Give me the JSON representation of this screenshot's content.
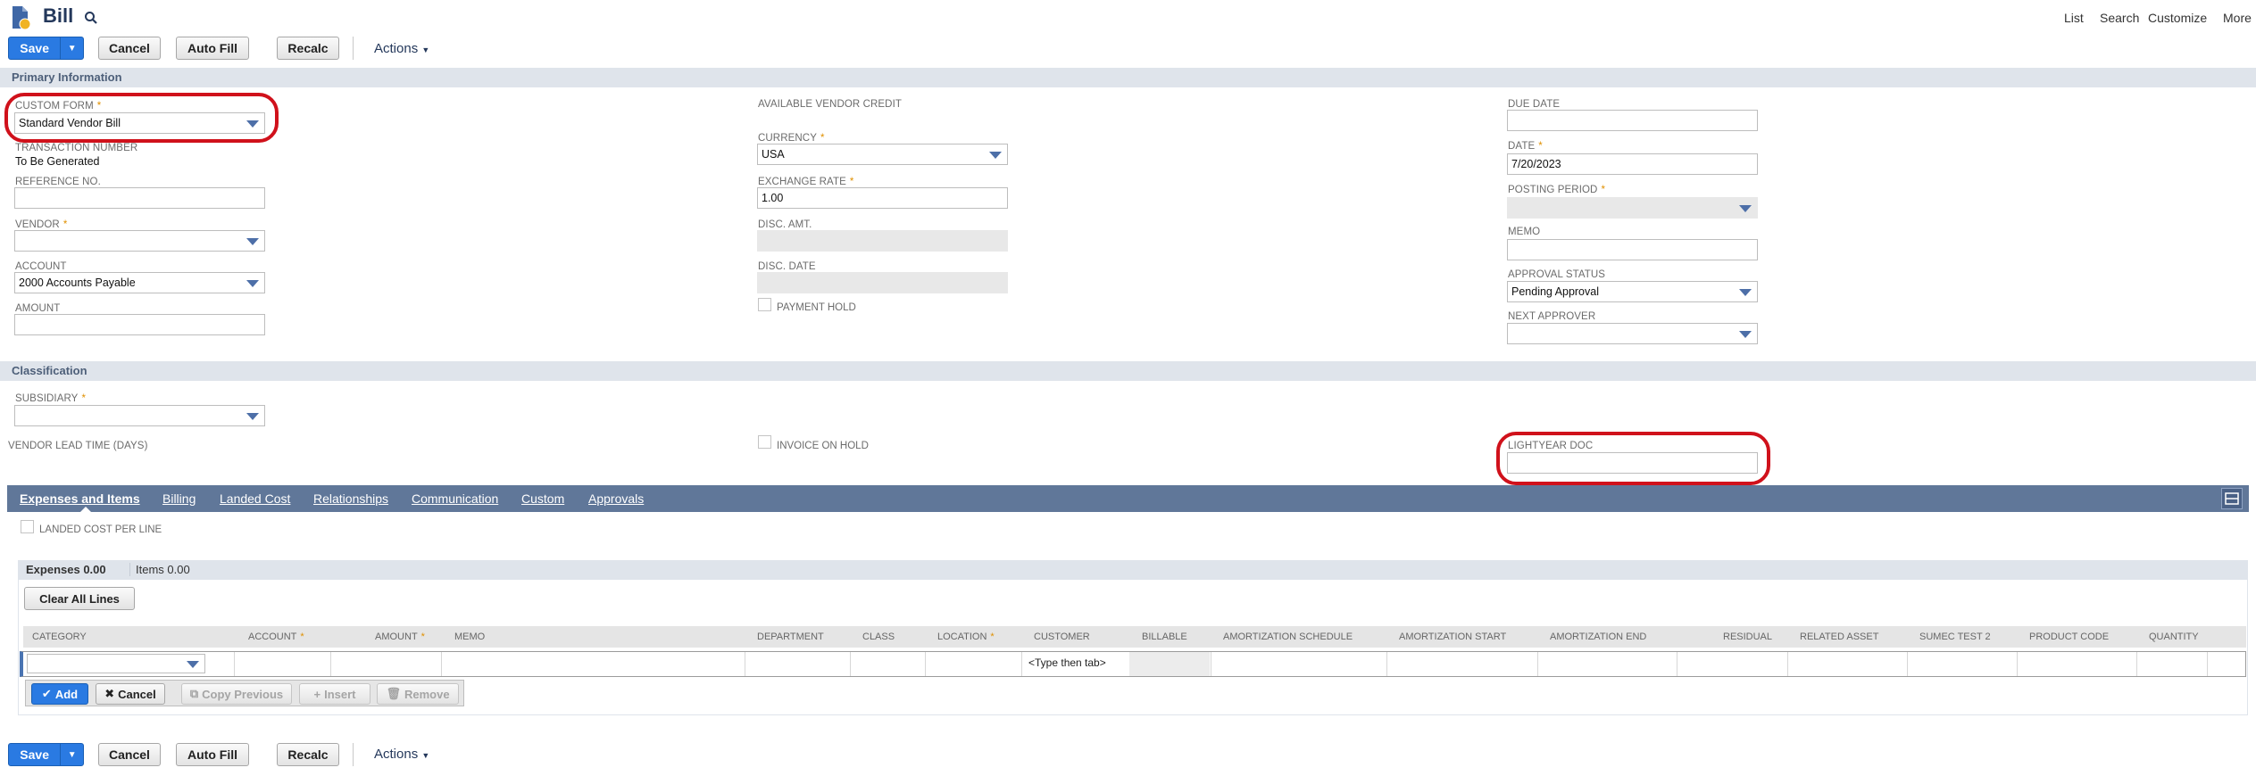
{
  "header": {
    "title": "Bill",
    "nav": [
      "List",
      "Search",
      "Customize",
      "More"
    ]
  },
  "toolbar": {
    "save": "Save",
    "cancel": "Cancel",
    "auto_fill": "Auto Fill",
    "recalc": "Recalc",
    "actions": "Actions"
  },
  "sections": {
    "primary": "Primary Information",
    "classification": "Classification"
  },
  "primary": {
    "custom_form": {
      "label": "CUSTOM FORM",
      "value": "Standard Vendor Bill"
    },
    "transaction_number": {
      "label": "TRANSACTION NUMBER",
      "value": "To Be Generated"
    },
    "reference_no": {
      "label": "REFERENCE NO."
    },
    "vendor": {
      "label": "VENDOR"
    },
    "account": {
      "label": "ACCOUNT",
      "value": "2000 Accounts Payable"
    },
    "amount": {
      "label": "AMOUNT"
    },
    "available_vendor_credit": {
      "label": "AVAILABLE VENDOR CREDIT"
    },
    "currency": {
      "label": "CURRENCY",
      "value": "USA"
    },
    "exchange_rate": {
      "label": "EXCHANGE RATE",
      "value": "1.00"
    },
    "disc_amt": {
      "label": "DISC. AMT."
    },
    "disc_date": {
      "label": "DISC. DATE"
    },
    "payment_hold": {
      "label": "PAYMENT HOLD"
    },
    "due_date": {
      "label": "DUE DATE"
    },
    "date": {
      "label": "DATE",
      "value": "7/20/2023"
    },
    "posting_period": {
      "label": "POSTING PERIOD"
    },
    "memo": {
      "label": "MEMO"
    },
    "approval_status": {
      "label": "APPROVAL STATUS",
      "value": "Pending Approval"
    },
    "next_approver": {
      "label": "NEXT APPROVER"
    }
  },
  "classification": {
    "subsidiary": {
      "label": "SUBSIDIARY"
    },
    "vendor_lead_time": {
      "label": "VENDOR LEAD TIME (DAYS)"
    },
    "invoice_on_hold": {
      "label": "INVOICE ON HOLD"
    },
    "lightyear_doc": {
      "label": "LIGHTYEAR DOC"
    }
  },
  "tabs": [
    "Expenses and Items",
    "Billing",
    "Landed Cost",
    "Relationships",
    "Communication",
    "Custom",
    "Approvals"
  ],
  "landed_cost_per_line": "LANDED COST PER LINE",
  "subtabs": {
    "expenses": "Expenses 0.00",
    "items": "Items 0.00"
  },
  "clear_all_lines": "Clear All Lines",
  "columns": [
    "CATEGORY",
    "ACCOUNT",
    "AMOUNT",
    "MEMO",
    "DEPARTMENT",
    "CLASS",
    "LOCATION",
    "CUSTOMER",
    "BILLABLE",
    "AMORTIZATION SCHEDULE",
    "AMORTIZATION START",
    "AMORTIZATION END",
    "RESIDUAL",
    "RELATED ASSET",
    "SUMEC TEST 2",
    "PRODUCT CODE",
    "QUANTITY"
  ],
  "customer_placeholder": "<Type then tab>",
  "row_buttons": {
    "add": "Add",
    "cancel": "Cancel",
    "copy_previous": "Copy Previous",
    "insert": "Insert",
    "remove": "Remove"
  },
  "colors": {
    "accent": "#2a7ae2",
    "tab_bar": "#607799",
    "highlight": "#d0111b",
    "required": "#e09000"
  }
}
